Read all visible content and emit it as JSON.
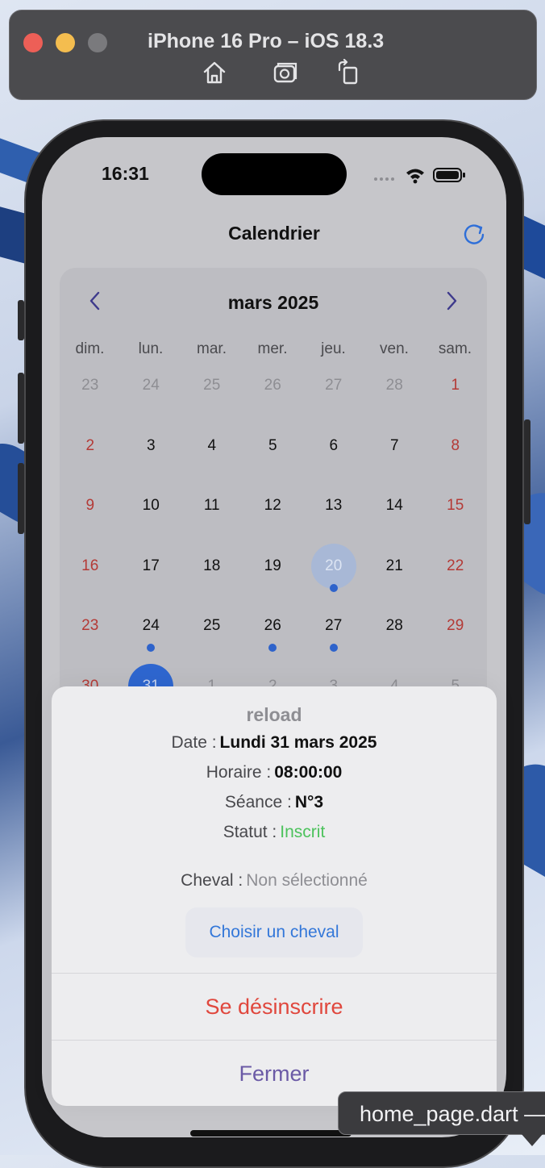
{
  "simulator": {
    "title": "iPhone 16 Pro – iOS 18.3",
    "toolbar": [
      "home-icon",
      "screenshot-icon",
      "rotate-icon"
    ]
  },
  "status_bar": {
    "time": "16:31"
  },
  "nav": {
    "title": "Calendrier"
  },
  "calendar": {
    "month_label": "mars 2025",
    "weekdays": [
      "dim.",
      "lun.",
      "mar.",
      "mer.",
      "jeu.",
      "ven.",
      "sam."
    ],
    "weeks": [
      [
        "23",
        "24",
        "25",
        "26",
        "27",
        "28",
        "1"
      ],
      [
        "2",
        "3",
        "4",
        "5",
        "6",
        "7",
        "8"
      ],
      [
        "9",
        "10",
        "11",
        "12",
        "13",
        "14",
        "15"
      ],
      [
        "16",
        "17",
        "18",
        "19",
        "20",
        "21",
        "22"
      ],
      [
        "23",
        "24",
        "25",
        "26",
        "27",
        "28",
        "29"
      ],
      [
        "30",
        "31",
        "1",
        "2",
        "3",
        "4",
        "5"
      ]
    ],
    "today": "20",
    "selected": "31",
    "event_days": [
      "20",
      "24",
      "26",
      "27"
    ],
    "weekend_color": "#b43a36",
    "selected_color": "#2e66cf",
    "event_dot_color": "#2e63cb"
  },
  "sheet": {
    "title": "reload",
    "date_label": "Date :",
    "date_value": "Lundi 31 mars 2025",
    "time_label": "Horaire :",
    "time_value": "08:00:00",
    "session_label": "Séance :",
    "session_value": "N°3",
    "status_label": "Statut :",
    "status_value": "Inscrit",
    "horse_label": "Cheval :",
    "horse_value": "Non sélectionné",
    "choose_horse_button": "Choisir un cheval",
    "unsubscribe_button": "Se désinscrire",
    "close_button": "Fermer"
  },
  "tooltip": {
    "text": "home_page.dart —"
  }
}
